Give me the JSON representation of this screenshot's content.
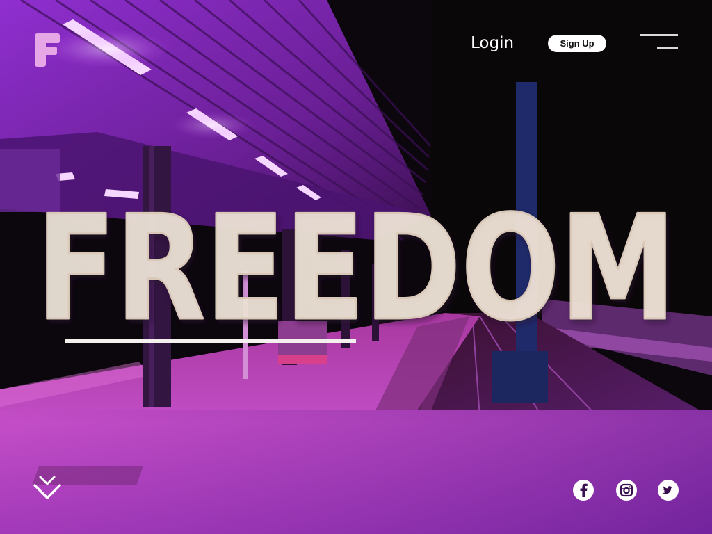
{
  "brand": {
    "logo_letter": "F",
    "logo_color": "#e7a6e6"
  },
  "nav": {
    "login_label": "Login",
    "signup_label": "Sign Up",
    "menu_icon": "hamburger-menu-icon"
  },
  "hero": {
    "headline": "FREEDOM",
    "headline_color": "#ede2d6"
  },
  "scroll": {
    "icon": "double-chevron-down-icon"
  },
  "social": [
    {
      "network": "facebook",
      "icon": "facebook-icon"
    },
    {
      "network": "instagram",
      "icon": "instagram-icon"
    },
    {
      "network": "twitter",
      "icon": "twitter-icon"
    }
  ],
  "colors": {
    "accent_magenta": "#c63ec9",
    "accent_purple": "#7a2db0",
    "background": "#0b070d",
    "white": "#ffffff"
  }
}
